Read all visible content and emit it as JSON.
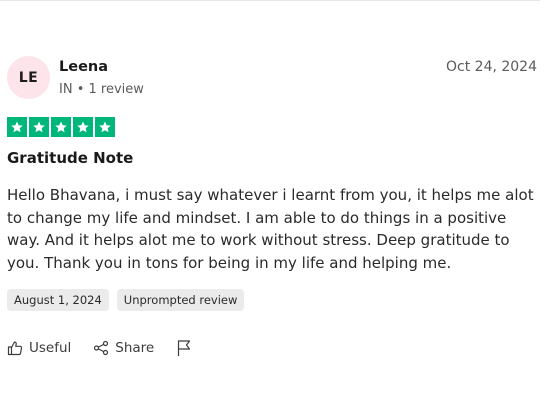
{
  "reviewer": {
    "initials": "LE",
    "name": "Leena",
    "meta": "IN • 1 review"
  },
  "review": {
    "date": "Oct 24, 2024",
    "rating": 5,
    "title": "Gratitude Note",
    "body": "Hello Bhavana, i must say whatever i learnt from you, it helps me alot to change my life and mindset. I am able to do things in a positive way. And it helps alot me to work without stress. Deep gratitude to you. Thank you in tons for being in my life and helping me.",
    "tags": [
      "August 1, 2024",
      "Unprompted review"
    ]
  },
  "actions": {
    "useful_label": "Useful",
    "share_label": "Share",
    "useful_icon": "thumbs-up-icon",
    "share_icon": "share-icon",
    "flag_icon": "flag-icon"
  },
  "colors": {
    "star_green": "#00b67a",
    "avatar_bg": "#fde3ea",
    "tag_bg": "#ebebeb"
  }
}
